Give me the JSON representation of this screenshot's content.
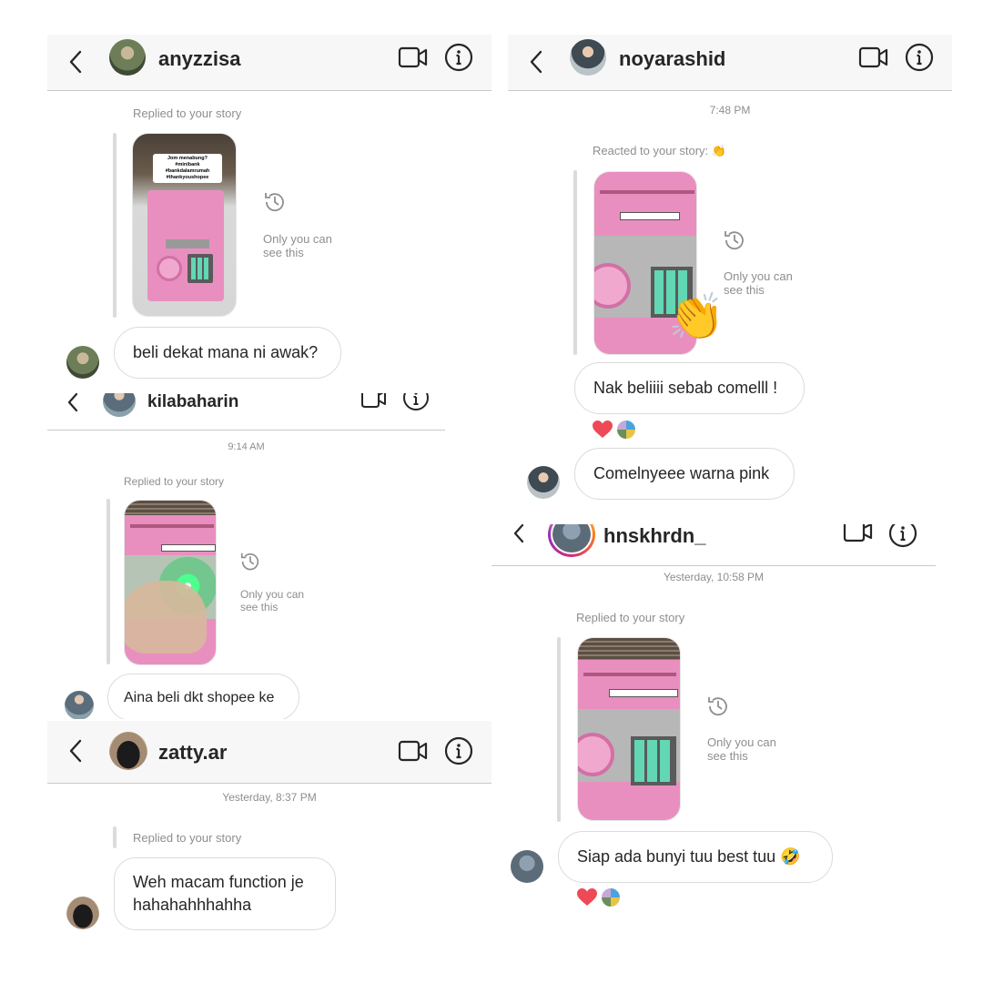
{
  "colors": {
    "header_bg": "#f7f7f7",
    "divider": "#c9c9c9",
    "meta_text": "#8e8e8e",
    "bubble_border": "#dbdbdb",
    "heart": "#ed4956",
    "piggy_pink": "#e98fbf",
    "keypad_green": "#62d7b4"
  },
  "icons": {
    "back": "chevron-left-icon",
    "video": "video-camera-icon",
    "info": "info-circle-icon",
    "history": "history-clock-icon",
    "heart": "heart-icon"
  },
  "chat1": {
    "username": "anyzzisa",
    "story_caption": "Replied to your story",
    "story_overlay": [
      "Jom menabung?",
      "#minibank #bankdalamrumah",
      "#thankyoushopee"
    ],
    "only_you": [
      "Only you can",
      "see this"
    ],
    "message": "beli dekat mana ni awak?"
  },
  "chat2": {
    "username": "noyarashid",
    "timestamp": "7:48 PM",
    "story_caption": "Reacted to your story: 👏",
    "reaction_emoji": "👏",
    "only_you": [
      "Only you can",
      "see this"
    ],
    "message1": "Nak beliiii sebab comelll !",
    "message2": "Comelnyeee warna pink"
  },
  "chat3": {
    "username": "kilabaharin",
    "timestamp": "9:14 AM",
    "story_caption": "Replied to your story",
    "only_you": [
      "Only you can",
      "see this"
    ],
    "message": "Aina beli dkt shopee ke"
  },
  "chat4": {
    "username": "hnskhrdn_",
    "timestamp": "Yesterday, 10:58 PM",
    "story_caption": "Replied to your story",
    "only_you": [
      "Only you can",
      "see this"
    ],
    "message": "Siap ada bunyi tuu best tuu 🤣"
  },
  "chat5": {
    "username": "zatty.ar",
    "timestamp": "Yesterday, 8:37 PM",
    "story_caption": "Replied to your story",
    "message_lines": [
      "Weh macam function je",
      "hahahahhhahha"
    ]
  }
}
